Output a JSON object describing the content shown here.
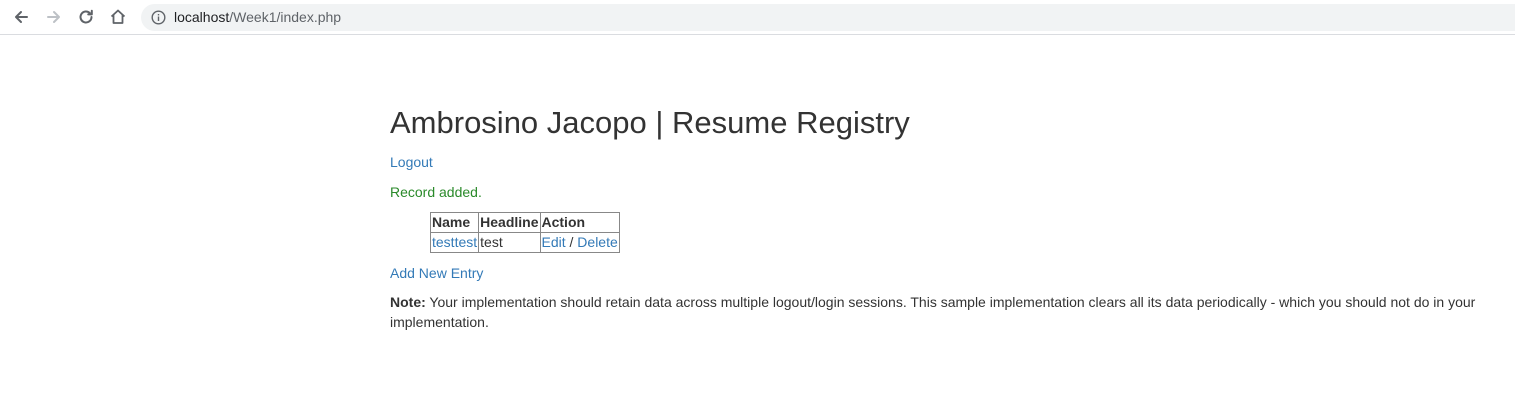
{
  "browser": {
    "url_host": "localhost",
    "url_path": "/Week1/index.php"
  },
  "page": {
    "title": "Ambrosino Jacopo | Resume Registry",
    "logout_label": "Logout",
    "flash_message": "Record added.",
    "table": {
      "headers": [
        "Name",
        "Headline",
        "Action"
      ],
      "rows": [
        {
          "name": "testtest",
          "headline": "test",
          "edit": "Edit",
          "separator": " / ",
          "delete": "Delete"
        }
      ]
    },
    "add_entry_label": "Add New Entry",
    "note_label": "Note:",
    "note_text": " Your implementation should retain data across multiple logout/login sessions. This sample implementation clears all its data periodically - which you should not do in your implementation."
  },
  "colors": {
    "link": "#337ab7",
    "success": "#2a8a2a",
    "text": "#333333"
  }
}
